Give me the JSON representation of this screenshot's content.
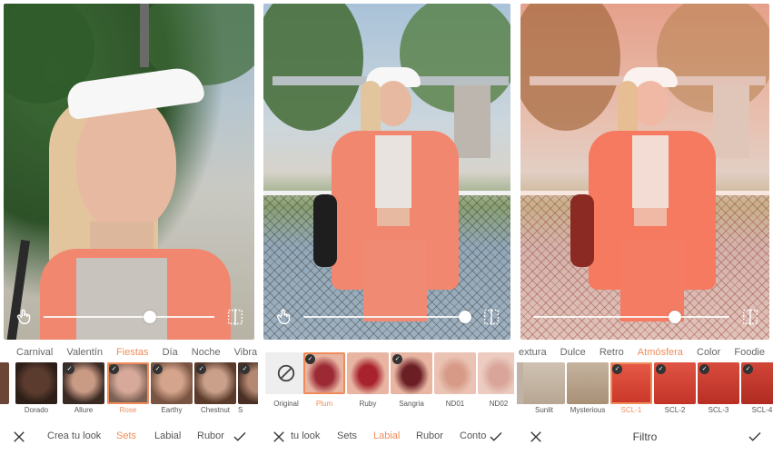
{
  "panel1": {
    "categories": [
      {
        "label": "Carnival",
        "active": false
      },
      {
        "label": "Valentín",
        "active": false
      },
      {
        "label": "Fiestas",
        "active": true
      },
      {
        "label": "Día",
        "active": false
      },
      {
        "label": "Noche",
        "active": false
      },
      {
        "label": "Vibra",
        "active": false
      }
    ],
    "thumbs": [
      {
        "label": "Dorado",
        "selected": false,
        "checked": false,
        "tone": "#5a3b2e"
      },
      {
        "label": "Allure",
        "selected": false,
        "checked": true,
        "tone": "#7a4a3b"
      },
      {
        "label": "Rose",
        "selected": true,
        "checked": true,
        "tone": "#b4847a"
      },
      {
        "label": "Earthy",
        "selected": false,
        "checked": true,
        "tone": "#a87561"
      },
      {
        "label": "Chestnut",
        "selected": false,
        "checked": true,
        "tone": "#8e5a44"
      },
      {
        "label": "S",
        "selected": false,
        "checked": true,
        "tone": "#6e4b3a"
      }
    ],
    "bottom_tabs": [
      {
        "label": "Crea tu look",
        "active": false
      },
      {
        "label": "Sets",
        "active": true
      },
      {
        "label": "Labial",
        "active": false
      },
      {
        "label": "Rubor",
        "active": false
      }
    ],
    "slider_value": 0.62
  },
  "panel2": {
    "thumbs": [
      {
        "label": "Original",
        "selected": false,
        "checked": false,
        "tone": "#eeeeee"
      },
      {
        "label": "Plum",
        "selected": true,
        "checked": true,
        "tone": "#9c2a35"
      },
      {
        "label": "Ruby",
        "selected": false,
        "checked": false,
        "tone": "#a8232e"
      },
      {
        "label": "Sangria",
        "selected": false,
        "checked": true,
        "tone": "#6b1e24"
      },
      {
        "label": "ND01",
        "selected": false,
        "checked": false,
        "tone": "#d79a86"
      },
      {
        "label": "ND02",
        "selected": false,
        "checked": false,
        "tone": "#d9a59a"
      }
    ],
    "bottom_tabs": [
      {
        "label": "tu look",
        "active": false
      },
      {
        "label": "Sets",
        "active": false
      },
      {
        "label": "Labial",
        "active": true
      },
      {
        "label": "Rubor",
        "active": false
      },
      {
        "label": "Conto",
        "active": false
      }
    ],
    "slider_value": 0.97
  },
  "panel3": {
    "categories": [
      {
        "label": "extura",
        "active": false
      },
      {
        "label": "Dulce",
        "active": false
      },
      {
        "label": "Retro",
        "active": false
      },
      {
        "label": "Atmósfera",
        "active": true
      },
      {
        "label": "Color",
        "active": false
      },
      {
        "label": "Foodie",
        "active": false
      }
    ],
    "thumbs": [
      {
        "label": "Sunlit",
        "selected": false,
        "checked": false,
        "tone": "#c9b8a6"
      },
      {
        "label": "Mysterious",
        "selected": false,
        "checked": false,
        "tone": "#b9a58f"
      },
      {
        "label": "SCL-1",
        "selected": true,
        "checked": true,
        "tone": "#e04a3a"
      },
      {
        "label": "SCL-2",
        "selected": false,
        "checked": true,
        "tone": "#d84636"
      },
      {
        "label": "SCL-3",
        "selected": false,
        "checked": true,
        "tone": "#cc3f31"
      },
      {
        "label": "SCL-4",
        "selected": false,
        "checked": true,
        "tone": "#c63a2e"
      }
    ],
    "center_title": "Filtro",
    "slider_value": 0.72
  },
  "colors": {
    "accent": "#f08c5a",
    "text": "#555555",
    "coral": "#f2876f"
  }
}
